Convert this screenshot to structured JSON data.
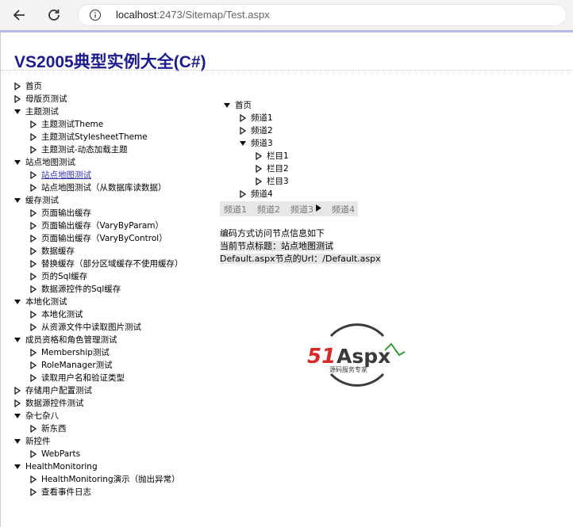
{
  "browser": {
    "url_host": "localhost",
    "url_path": ":2473/Sitemap/Test.aspx",
    "back_icon": "back-arrow-icon",
    "reload_icon": "reload-icon",
    "info_icon": "info-icon"
  },
  "page": {
    "title": "VS2005典型实例大全(C#)"
  },
  "sitemap_tree": [
    {
      "label": "首页",
      "level": 0,
      "state": "collapsed"
    },
    {
      "label": "母版页测试",
      "level": 0,
      "state": "collapsed"
    },
    {
      "label": "主题测试",
      "level": 0,
      "state": "expanded"
    },
    {
      "label": "主题测试Theme",
      "level": 1,
      "state": "collapsed"
    },
    {
      "label": "主题测试StylesheetTheme",
      "level": 1,
      "state": "collapsed"
    },
    {
      "label": "主题测试-动态加载主题",
      "level": 1,
      "state": "collapsed"
    },
    {
      "label": "站点地图测试",
      "level": 0,
      "state": "expanded"
    },
    {
      "label": "站点地图测试",
      "level": 1,
      "state": "collapsed",
      "selected": true
    },
    {
      "label": "站点地图测试（从数据库读数据）",
      "level": 1,
      "state": "collapsed"
    },
    {
      "label": "缓存测试",
      "level": 0,
      "state": "expanded"
    },
    {
      "label": "页面输出缓存",
      "level": 1,
      "state": "collapsed"
    },
    {
      "label": "页面输出缓存（VaryByParam）",
      "level": 1,
      "state": "collapsed"
    },
    {
      "label": "页面输出缓存（VaryByControl）",
      "level": 1,
      "state": "collapsed"
    },
    {
      "label": "数据缓存",
      "level": 1,
      "state": "collapsed"
    },
    {
      "label": "替换缓存（部分区域缓存不使用缓存）",
      "level": 1,
      "state": "collapsed"
    },
    {
      "label": "页的Sql缓存",
      "level": 1,
      "state": "collapsed"
    },
    {
      "label": "数据源控件的Sql缓存",
      "level": 1,
      "state": "collapsed"
    },
    {
      "label": "本地化测试",
      "level": 0,
      "state": "expanded"
    },
    {
      "label": "本地化测试",
      "level": 1,
      "state": "collapsed"
    },
    {
      "label": "从资源文件中读取图片测试",
      "level": 1,
      "state": "collapsed"
    },
    {
      "label": "成员资格和角色管理测试",
      "level": 0,
      "state": "expanded"
    },
    {
      "label": "Membership测试",
      "level": 1,
      "state": "collapsed"
    },
    {
      "label": "RoleManager测试",
      "level": 1,
      "state": "collapsed"
    },
    {
      "label": "读取用户名和验证类型",
      "level": 1,
      "state": "collapsed"
    },
    {
      "label": "存储用户配置测试",
      "level": 0,
      "state": "collapsed"
    },
    {
      "label": "数据源控件测试",
      "level": 0,
      "state": "collapsed"
    },
    {
      "label": "杂七杂八",
      "level": 0,
      "state": "expanded"
    },
    {
      "label": "新东西",
      "level": 1,
      "state": "collapsed"
    },
    {
      "label": "新控件",
      "level": 0,
      "state": "expanded"
    },
    {
      "label": "WebParts",
      "level": 1,
      "state": "collapsed"
    },
    {
      "label": "HealthMonitoring",
      "level": 0,
      "state": "expanded"
    },
    {
      "label": "HealthMonitoring演示（抛出异常）",
      "level": 1,
      "state": "collapsed"
    },
    {
      "label": "查看事件日志",
      "level": 1,
      "state": "collapsed"
    }
  ],
  "channel_tree": [
    {
      "label": "首页",
      "level": 0,
      "state": "expanded"
    },
    {
      "label": "频道1",
      "level": 1,
      "state": "collapsed"
    },
    {
      "label": "频道2",
      "level": 1,
      "state": "collapsed"
    },
    {
      "label": "频道3",
      "level": 1,
      "state": "expanded"
    },
    {
      "label": "栏目1",
      "level": 2,
      "state": "collapsed"
    },
    {
      "label": "栏目2",
      "level": 2,
      "state": "collapsed"
    },
    {
      "label": "栏目3",
      "level": 2,
      "state": "collapsed"
    },
    {
      "label": "频道4",
      "level": 1,
      "state": "collapsed"
    }
  ],
  "menu": {
    "items": [
      "频道1",
      "频道2",
      "频道3",
      "频道4"
    ],
    "arrow_after_index": 2
  },
  "info": {
    "heading": "编码方式访问节点信息如下",
    "title_line": "当前节点标题：站点地图测试",
    "url_line": "Default.aspx节点的Url：/Default.aspx"
  },
  "logo": {
    "text_51": "51",
    "text_aspx": "Aspx",
    "tagline": "源码服务专家",
    "colors": {
      "red": "#d42a2a",
      "dark": "#3a3a3a",
      "green": "#3a9a3a"
    }
  }
}
